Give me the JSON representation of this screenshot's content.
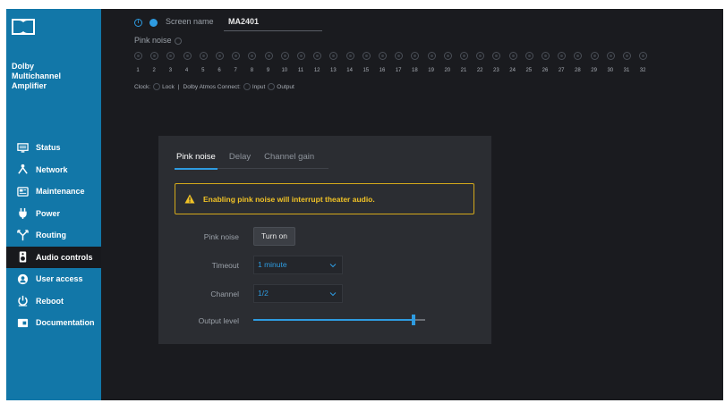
{
  "sidebar": {
    "product_lines": [
      "Dolby",
      "Multichannel",
      "Amplifier"
    ],
    "items": [
      {
        "label": "Status",
        "icon": "monitor-icon",
        "active": false
      },
      {
        "label": "Network",
        "icon": "network-icon",
        "active": false
      },
      {
        "label": "Maintenance",
        "icon": "maintenance-icon",
        "active": false
      },
      {
        "label": "Power",
        "icon": "power-plug-icon",
        "active": false
      },
      {
        "label": "Routing",
        "icon": "routing-icon",
        "active": false
      },
      {
        "label": "Audio controls",
        "icon": "speaker-icon",
        "active": true
      },
      {
        "label": "User access",
        "icon": "user-access-icon",
        "active": false
      },
      {
        "label": "Reboot",
        "icon": "reboot-icon",
        "active": false
      },
      {
        "label": "Documentation",
        "icon": "documentation-icon",
        "active": false
      }
    ]
  },
  "header": {
    "screen_name_label": "Screen name",
    "screen_name_value": "MA2401"
  },
  "pink_noise_header": "Pink noise",
  "channels": [
    "1",
    "2",
    "3",
    "4",
    "5",
    "6",
    "7",
    "8",
    "9",
    "10",
    "11",
    "12",
    "13",
    "14",
    "15",
    "16",
    "17",
    "18",
    "19",
    "20",
    "21",
    "22",
    "23",
    "24",
    "25",
    "26",
    "27",
    "28",
    "29",
    "30",
    "31",
    "32"
  ],
  "clock_row": {
    "clock_label": "Clock:",
    "lock_label": "Lock",
    "separator": "|",
    "connect_label": "Dolby Atmos Connect:",
    "input_label": "Input",
    "output_label": "Output"
  },
  "panel": {
    "tabs": [
      {
        "label": "Pink noise",
        "active": true
      },
      {
        "label": "Delay",
        "active": false
      },
      {
        "label": "Channel gain",
        "active": false
      }
    ],
    "warning": "Enabling pink noise will interrupt theater audio.",
    "pink_noise_label": "Pink noise",
    "turn_on_label": "Turn on",
    "timeout_label": "Timeout",
    "timeout_value": "1 minute",
    "channel_label": "Channel",
    "channel_value": "1/2",
    "output_level_label": "Output level",
    "output_level": 0.93
  },
  "colors": {
    "sidebar": "#1277a8",
    "accent": "#2e9be0",
    "warning": "#f0c226",
    "background": "#1a1b1f",
    "panel": "#2b2d32"
  }
}
